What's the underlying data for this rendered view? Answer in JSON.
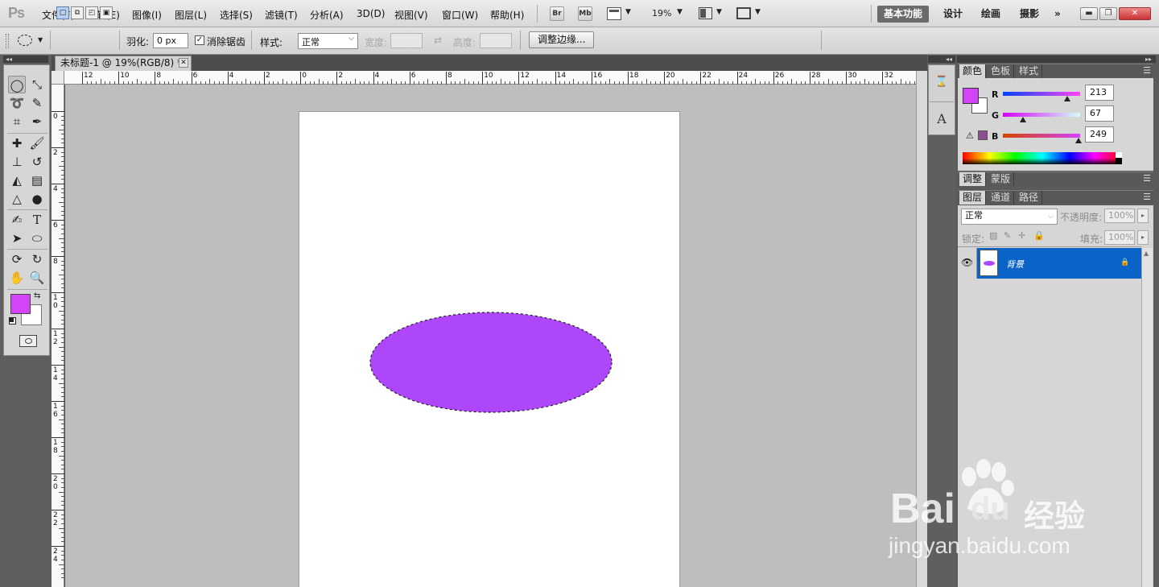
{
  "app": {
    "logo": "Ps",
    "menu": [
      "文件(F)",
      "编辑(E)",
      "图像(I)",
      "图层(L)",
      "选择(S)",
      "滤镜(T)",
      "分析(A)",
      "3D(D)",
      "视图(V)",
      "窗口(W)",
      "帮助(H)"
    ],
    "bridge_label": "Br",
    "minibridge_label": "Mb",
    "zoom": "19%",
    "workspaces": [
      "基本功能",
      "设计",
      "绘画",
      "摄影"
    ],
    "more_workspaces": "»",
    "window_controls": [
      "▬",
      "❐",
      "✕"
    ]
  },
  "options": {
    "feather_label": "羽化:",
    "feather_value": "0 px",
    "antialias_label": "消除锯齿",
    "antialias_checked": true,
    "style_label": "样式:",
    "style_value": "正常",
    "width_label": "宽度:",
    "height_label": "高度:",
    "refine_edge": "调整边缘..."
  },
  "document": {
    "tab_title": "未标题-1 @ 19%(RGB/8) *",
    "close": "✕",
    "ruler_top": [
      "12",
      "10",
      "8",
      "6",
      "4",
      "2",
      "0",
      "2",
      "4",
      "6",
      "8",
      "10",
      "12",
      "14",
      "16",
      "18",
      "20",
      "22",
      "24",
      "26",
      "28",
      "30",
      "32"
    ],
    "ruler_left": [
      "0",
      "2",
      "4",
      "6",
      "8",
      "10",
      "12",
      "14",
      "16",
      "18",
      "20",
      "22",
      "24"
    ],
    "shape_color": "#AE47F9"
  },
  "color_panel": {
    "tabs": [
      "颜色",
      "色板",
      "样式"
    ],
    "foreground": "#D543F9",
    "background": "#FFFFFF",
    "channels": [
      {
        "label": "R",
        "value": "213",
        "fraction": 0.835
      },
      {
        "label": "G",
        "value": "67",
        "fraction": 0.263
      },
      {
        "label": "B",
        "value": "249",
        "fraction": 0.976
      }
    ]
  },
  "adjust_panel": {
    "tabs": [
      "调整",
      "蒙版"
    ]
  },
  "layers_panel": {
    "tabs": [
      "图层",
      "通道",
      "路径"
    ],
    "blend_mode": "正常",
    "opacity_label": "不透明度:",
    "opacity_value": "100%",
    "lock_label": "锁定:",
    "fill_label": "填充:",
    "fill_value": "100%",
    "layers": [
      {
        "name": "背景",
        "visible": true,
        "locked": true
      }
    ]
  },
  "watermark": {
    "brand": "Bai",
    "brand2": "du",
    "product": "经验",
    "url": "jingyan.baidu.com"
  }
}
